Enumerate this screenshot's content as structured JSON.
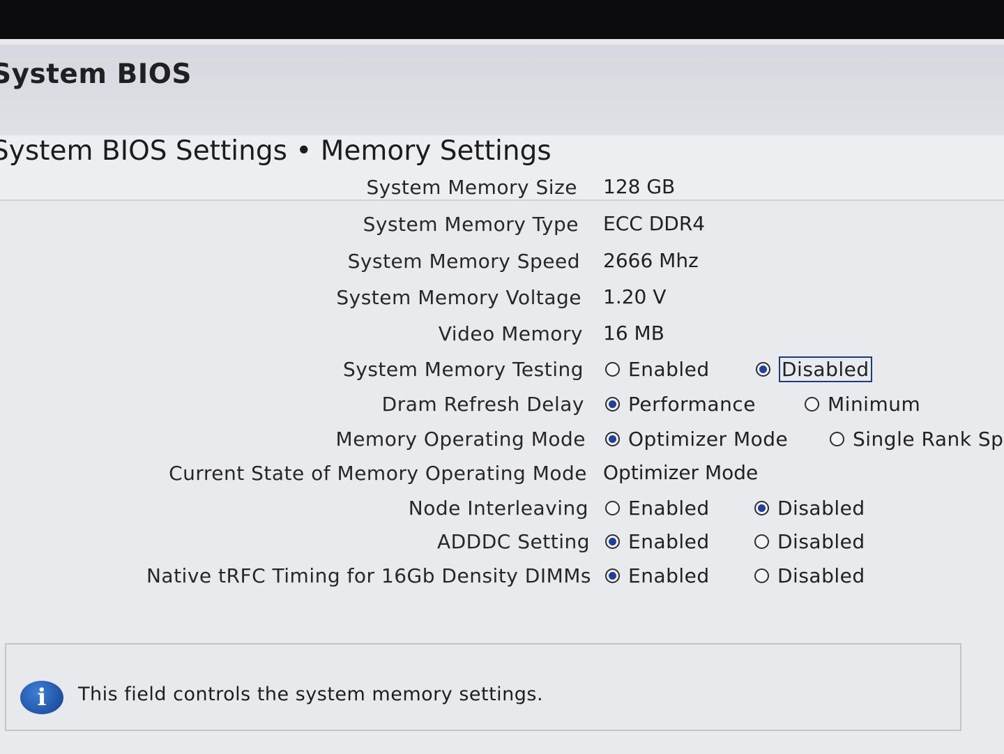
{
  "app_title": "System BIOS",
  "page_title": "System BIOS Settings • Memory Settings",
  "settings": [
    {
      "label": "System Memory Size",
      "value": "128 GB"
    },
    {
      "label": "System Memory Type",
      "value": "ECC DDR4"
    },
    {
      "label": "System Memory Speed",
      "value": "2666 Mhz"
    },
    {
      "label": "System Memory Voltage",
      "value": "1.20 V"
    },
    {
      "label": "Video Memory",
      "value": "16 MB"
    },
    {
      "label": "System Memory Testing",
      "options": [
        "Enabled",
        "Disabled"
      ],
      "selected": "Disabled"
    },
    {
      "label": "Dram Refresh Delay",
      "options": [
        "Performance",
        "Minimum"
      ],
      "selected": "Performance"
    },
    {
      "label": "Memory Operating Mode",
      "options": [
        "Optimizer Mode",
        "Single Rank Spa"
      ],
      "selected": "Optimizer Mode"
    },
    {
      "label": "Current State of Memory Operating Mode",
      "value": "Optimizer Mode"
    },
    {
      "label": "Node Interleaving",
      "options": [
        "Enabled",
        "Disabled"
      ],
      "selected": "Disabled"
    },
    {
      "label": "ADDDC Setting",
      "options": [
        "Enabled",
        "Disabled"
      ],
      "selected": "Enabled"
    },
    {
      "label": "Native tRFC Timing for 16Gb Density DIMMs",
      "options": [
        "Enabled",
        "Disabled"
      ],
      "selected": "Enabled"
    }
  ],
  "focused_option": "System Memory Testing: Disabled",
  "help": {
    "icon": "info-icon",
    "icon_glyph": "i",
    "text": "This field controls the system memory settings."
  },
  "colors": {
    "radio_selected": "#1e3f9a",
    "focus_border": "#1f3a84",
    "info_icon": "#1a4fa8"
  }
}
